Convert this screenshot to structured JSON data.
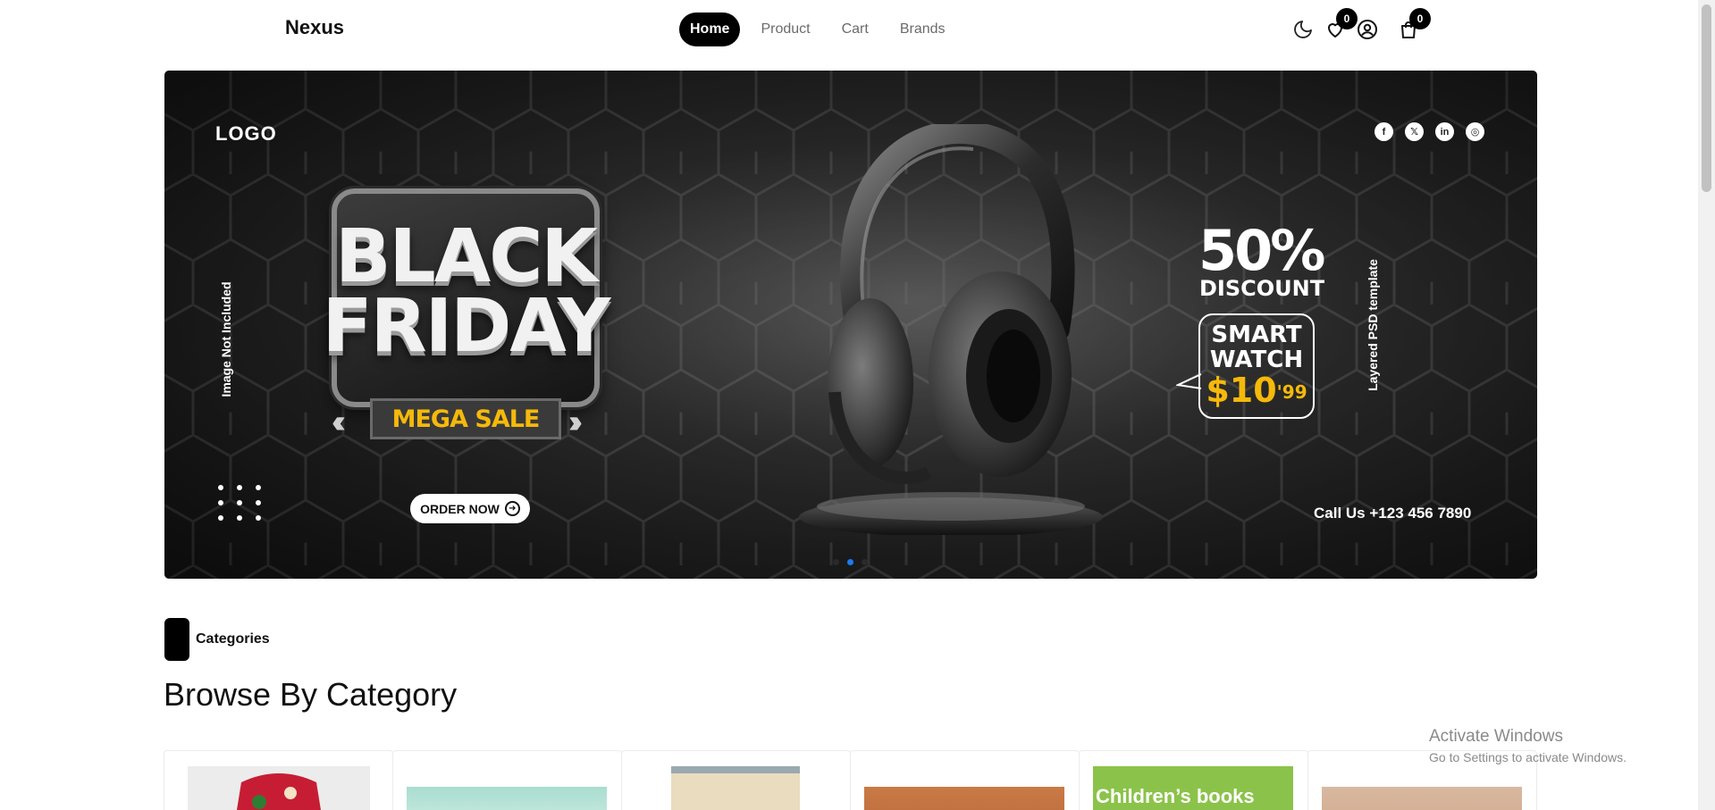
{
  "brand": "Nexus",
  "nav": {
    "links": [
      "Home",
      "Product",
      "Cart",
      "Brands"
    ],
    "active": "Home",
    "wishlist_count": "0",
    "cart_count": "0"
  },
  "hero": {
    "logo": "LOGO",
    "left_vertical": "Image Not Included",
    "right_vertical": "Layered PSD template",
    "headline_line1": "BLACK",
    "headline_line2": "FRIDAY",
    "mega_sale": "MEGA SALE",
    "order_button": "ORDER NOW",
    "discount_pct": "50%",
    "discount_label": "DISCOUNT",
    "watch_line1": "SMART",
    "watch_line2": "WATCH",
    "watch_price": "$10",
    "watch_cents": "'99",
    "call_us": "Call Us +123 456 7890",
    "social_icons": [
      "facebook-icon",
      "x-icon",
      "linkedin-icon",
      "instagram-icon"
    ],
    "slides": 3,
    "active_slide": 2
  },
  "categories": {
    "label": "Categories",
    "title": "Browse By Category",
    "cards": [
      {
        "name": "women-fashion",
        "text": ""
      },
      {
        "name": "category-2",
        "text": ""
      },
      {
        "name": "category-3",
        "text": ""
      },
      {
        "name": "category-4",
        "text": ""
      },
      {
        "name": "childrens-books",
        "text": "Children’s books"
      },
      {
        "name": "category-6",
        "text": ""
      }
    ]
  },
  "watermark": {
    "line1": "Activate Windows",
    "line2": "Go to Settings to activate Windows."
  },
  "colors": {
    "accent": "#000000",
    "carousel_active": "#1d7af3",
    "sale_yellow": "#f6b90a"
  }
}
